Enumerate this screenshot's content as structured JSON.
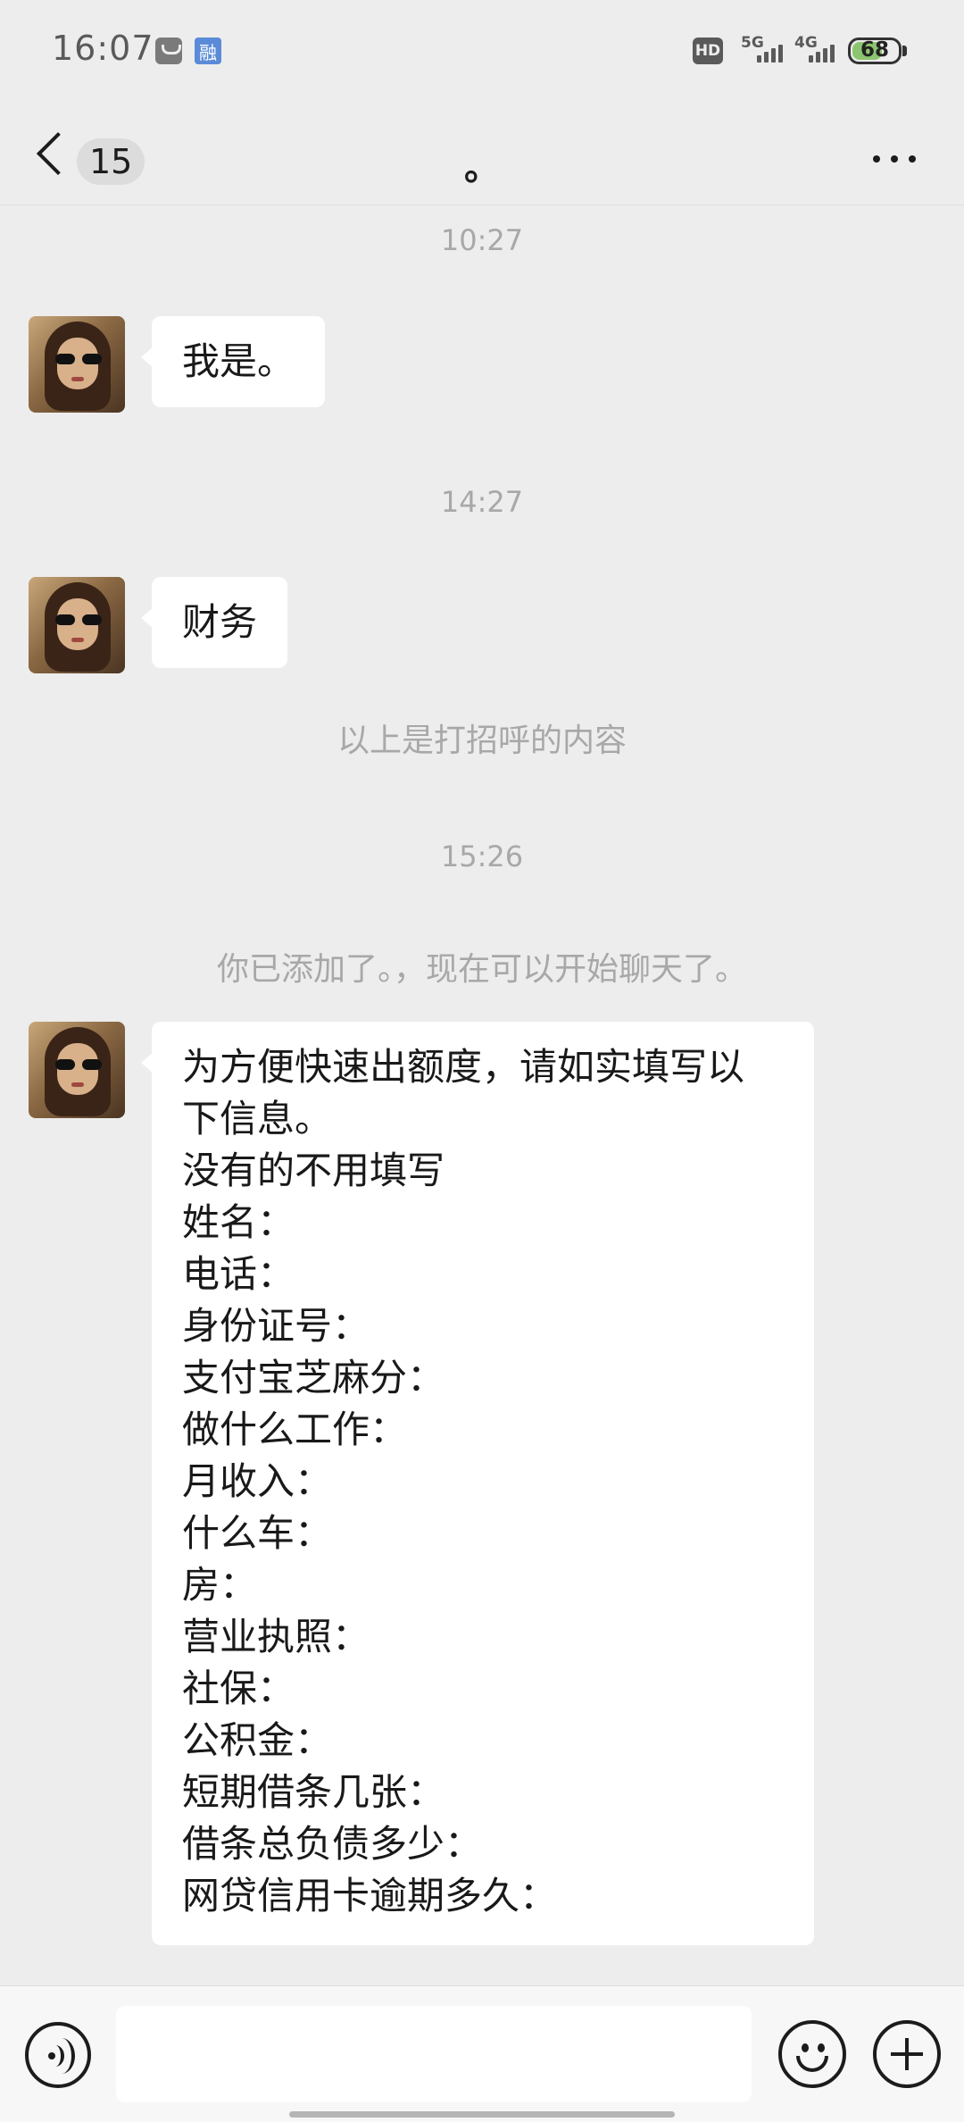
{
  "status_bar": {
    "time": "16:07",
    "notif_icon_2_text": "融",
    "hd_label": "HD",
    "net1": "5G",
    "net2": "4G",
    "battery": "68",
    "battery_level": 0.68
  },
  "nav": {
    "unread_count": "15",
    "title": "。"
  },
  "messages": {
    "ts1": "10:27",
    "bubble1": "我是。",
    "ts2": "14:27",
    "bubble2": "财务",
    "sys1": "以上是打招呼的内容",
    "ts3": "15:26",
    "sys2": "你已添加了。，现在可以开始聊天了。",
    "form_lines": [
      "为方便快速出额度，请如实填写以",
      "下信息。",
      "没有的不用填写",
      "姓名：",
      "电话：",
      "身份证号：",
      "支付宝芝麻分：",
      "做什么工作：",
      "月收入：",
      "什么车：",
      "房：",
      "营业执照：",
      "社保：",
      "公积金：",
      "短期借条几张：",
      "借条总负债多少：",
      "网贷信用卡逾期多久："
    ]
  },
  "input_bar": {
    "message_value": ""
  }
}
